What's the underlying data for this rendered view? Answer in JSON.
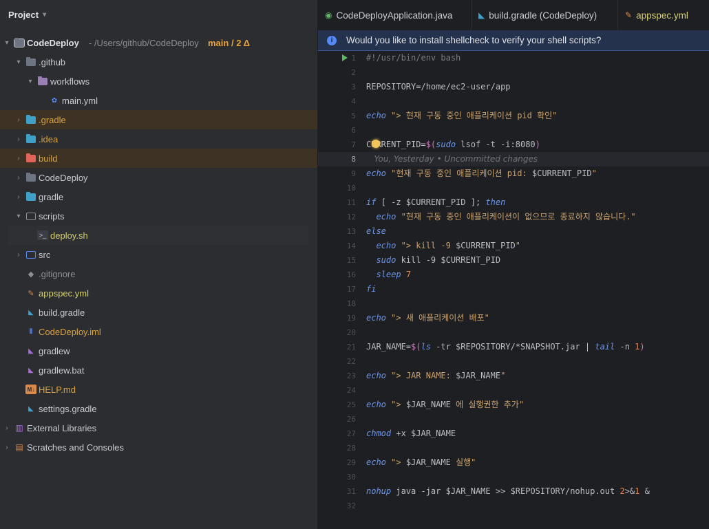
{
  "project": {
    "title": "Project",
    "root_name": "CodeDeploy",
    "root_path": "- /Users/github/CodeDeploy",
    "root_branch": "main",
    "root_changes": "/ 2 Δ",
    "items": [
      {
        "label": ".github",
        "color": "#c9ccd2"
      },
      {
        "label": "workflows",
        "color": "#c9ccd2"
      },
      {
        "label": "main.yml",
        "color": "#c9ccd2"
      },
      {
        "label": ".gradle",
        "color": "#d9a343"
      },
      {
        "label": ".idea",
        "color": "#d9a343"
      },
      {
        "label": "build",
        "color": "#d9a343"
      },
      {
        "label": "CodeDeploy",
        "color": "#c9ccd2"
      },
      {
        "label": "gradle",
        "color": "#c9ccd2"
      },
      {
        "label": "scripts",
        "color": "#c9ccd2"
      },
      {
        "label": "deploy.sh",
        "color": "#d5cf6e"
      },
      {
        "label": "src",
        "color": "#c9ccd2"
      },
      {
        "label": ".gitignore",
        "color": "#8c8f95"
      },
      {
        "label": "appspec.yml",
        "color": "#d5cf6e"
      },
      {
        "label": "build.gradle",
        "color": "#c9ccd2"
      },
      {
        "label": "CodeDeploy.iml",
        "color": "#d9a343"
      },
      {
        "label": "gradlew",
        "color": "#c9ccd2"
      },
      {
        "label": "gradlew.bat",
        "color": "#c9ccd2"
      },
      {
        "label": "HELP.md",
        "color": "#d9a343"
      },
      {
        "label": "settings.gradle",
        "color": "#c9ccd2"
      }
    ],
    "external_libraries": "External Libraries",
    "scratches": "Scratches and Consoles"
  },
  "tabs": [
    {
      "label": "CodeDeployApplication.java",
      "color": "#c9ccd2"
    },
    {
      "label": "build.gradle (CodeDeploy)",
      "color": "#c9ccd2"
    },
    {
      "label": "appspec.yml",
      "color": "#d5cf6e"
    }
  ],
  "banner": {
    "text": "Would you like to install shellcheck to verify your shell scripts?"
  },
  "editor": {
    "lines": [
      "#!/usr/bin/env bash",
      "",
      "REPOSITORY=/home/ec2-user/app",
      "",
      "echo \"> 현재 구동 중인 애플리케이션 pid 확인\"",
      "",
      "CURRENT_PID=$(sudo lsof -t -i:8080)",
      "",
      "echo \"현재 구동 중인 애플리케이션 pid: $CURRENT_PID\"",
      "",
      "if [ -z $CURRENT_PID ]; then",
      "  echo \"현재 구동 중인 애플리케이션이 없으므로 종료하지 않습니다.\"",
      "else",
      "  echo \"> kill -9 $CURRENT_PID\"",
      "  sudo kill -9 $CURRENT_PID",
      "  sleep 7",
      "fi",
      "",
      "echo \"> 새 애플리케이션 배포\"",
      "",
      "JAR_NAME=$(ls -tr $REPOSITORY/*SNAPSHOT.jar | tail -n 1)",
      "",
      "echo \"> JAR NAME: $JAR_NAME\"",
      "",
      "echo \"> $JAR_NAME 에 실행권한 추가\"",
      "",
      "chmod +x $JAR_NAME",
      "",
      "echo \"> $JAR_NAME 실행\"",
      "",
      "nohup java -jar $JAR_NAME >> $REPOSITORY/nohup.out 2>&1 &",
      ""
    ],
    "current_line": 8,
    "blame": "You, Yesterday • Uncommitted changes"
  },
  "colors": {
    "accent": "#548af7",
    "modified": "#d9a343",
    "new_file": "#d5cf6e",
    "run": "#5fb865",
    "branch": "#e8a33d"
  }
}
